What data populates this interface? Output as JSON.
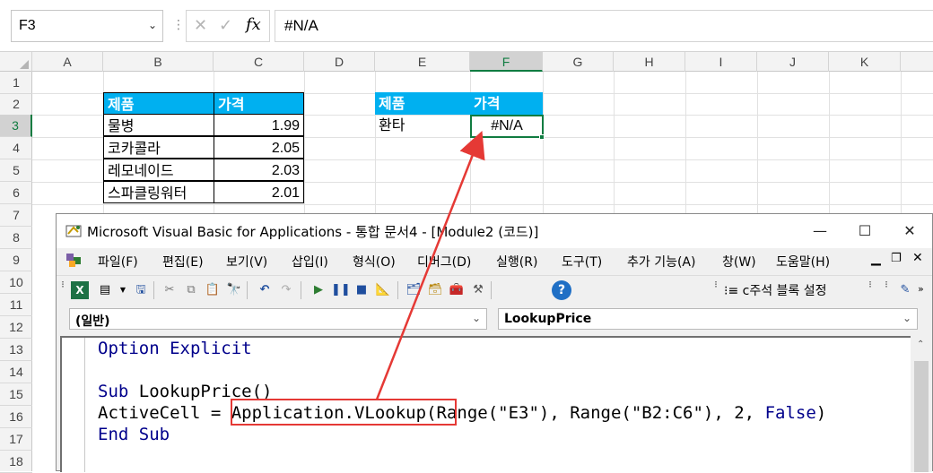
{
  "formula_bar": {
    "name_box": "F3",
    "formula": "#N/A",
    "cancel_glyph": "✕",
    "enter_glyph": "✓",
    "fx_label": "fx"
  },
  "columns": [
    "A",
    "B",
    "C",
    "D",
    "E",
    "F",
    "G",
    "H",
    "I",
    "J",
    "K"
  ],
  "rows": [
    "1",
    "2",
    "3",
    "4",
    "5",
    "6",
    "7",
    "8",
    "9",
    "10",
    "11",
    "12",
    "13",
    "14",
    "15",
    "16",
    "17",
    "18"
  ],
  "table1": {
    "header": [
      "제품",
      "가격"
    ],
    "rows": [
      [
        "물병",
        "1.99"
      ],
      [
        "코카콜라",
        "2.05"
      ],
      [
        "레모네이드",
        "2.03"
      ],
      [
        "스파클링워터",
        "2.01"
      ]
    ]
  },
  "table2": {
    "header": [
      "제품",
      "가격"
    ],
    "product": "환타",
    "price": "#N/A"
  },
  "vba": {
    "title": "Microsoft Visual Basic for Applications - 통합 문서4 - [Module2 (코드)]",
    "menu": [
      "파일(F)",
      "편집(E)",
      "보기(V)",
      "삽입(I)",
      "형식(O)",
      "디버그(D)",
      "실행(R)",
      "도구(T)",
      "추가 기능(A)",
      "창(W)",
      "도움말(H)"
    ],
    "comment_block_label": "c주석 블록 설정",
    "object_combo": "(일반)",
    "procedure_combo": "LookupPrice",
    "code": {
      "line1_kw": "Option Explicit",
      "line3_kw": "Sub",
      "line3_rest": " LookupPrice()",
      "line4_pre": "ActiveCell = ",
      "line4_highlight": "Application.VLookup",
      "line4_mid": "(Range(\"E3\"), Range(\"B2:C6\"), 2, ",
      "line4_kw": "False",
      "line4_end": ")",
      "line5_kw": "End Sub"
    }
  },
  "colors": {
    "header_fill": "#00b0f0",
    "excel_green": "#107c41",
    "vba_keyword": "#00008b",
    "annotation": "#e53935"
  }
}
